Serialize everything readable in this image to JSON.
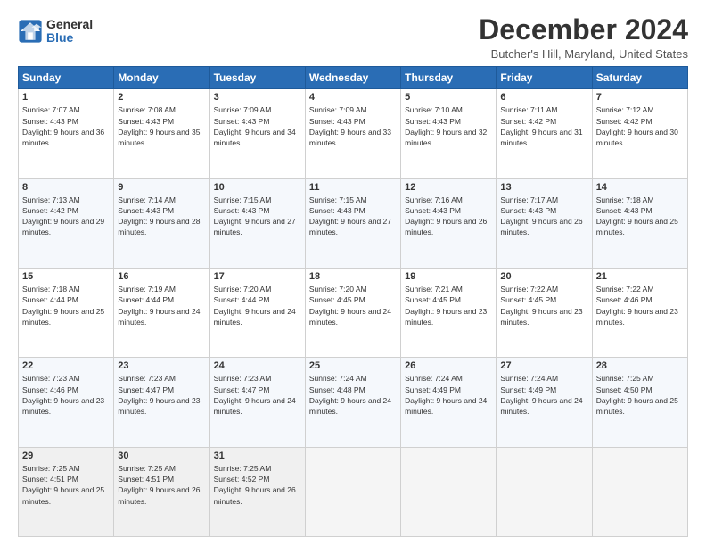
{
  "logo": {
    "general": "General",
    "blue": "Blue"
  },
  "header": {
    "month": "December 2024",
    "location": "Butcher's Hill, Maryland, United States"
  },
  "days_of_week": [
    "Sunday",
    "Monday",
    "Tuesday",
    "Wednesday",
    "Thursday",
    "Friday",
    "Saturday"
  ],
  "weeks": [
    [
      {
        "day": "1",
        "sunrise": "7:07 AM",
        "sunset": "4:43 PM",
        "daylight": "9 hours and 36 minutes."
      },
      {
        "day": "2",
        "sunrise": "7:08 AM",
        "sunset": "4:43 PM",
        "daylight": "9 hours and 35 minutes."
      },
      {
        "day": "3",
        "sunrise": "7:09 AM",
        "sunset": "4:43 PM",
        "daylight": "9 hours and 34 minutes."
      },
      {
        "day": "4",
        "sunrise": "7:09 AM",
        "sunset": "4:43 PM",
        "daylight": "9 hours and 33 minutes."
      },
      {
        "day": "5",
        "sunrise": "7:10 AM",
        "sunset": "4:43 PM",
        "daylight": "9 hours and 32 minutes."
      },
      {
        "day": "6",
        "sunrise": "7:11 AM",
        "sunset": "4:42 PM",
        "daylight": "9 hours and 31 minutes."
      },
      {
        "day": "7",
        "sunrise": "7:12 AM",
        "sunset": "4:42 PM",
        "daylight": "9 hours and 30 minutes."
      }
    ],
    [
      {
        "day": "8",
        "sunrise": "7:13 AM",
        "sunset": "4:42 PM",
        "daylight": "9 hours and 29 minutes."
      },
      {
        "day": "9",
        "sunrise": "7:14 AM",
        "sunset": "4:43 PM",
        "daylight": "9 hours and 28 minutes."
      },
      {
        "day": "10",
        "sunrise": "7:15 AM",
        "sunset": "4:43 PM",
        "daylight": "9 hours and 27 minutes."
      },
      {
        "day": "11",
        "sunrise": "7:15 AM",
        "sunset": "4:43 PM",
        "daylight": "9 hours and 27 minutes."
      },
      {
        "day": "12",
        "sunrise": "7:16 AM",
        "sunset": "4:43 PM",
        "daylight": "9 hours and 26 minutes."
      },
      {
        "day": "13",
        "sunrise": "7:17 AM",
        "sunset": "4:43 PM",
        "daylight": "9 hours and 26 minutes."
      },
      {
        "day": "14",
        "sunrise": "7:18 AM",
        "sunset": "4:43 PM",
        "daylight": "9 hours and 25 minutes."
      }
    ],
    [
      {
        "day": "15",
        "sunrise": "7:18 AM",
        "sunset": "4:44 PM",
        "daylight": "9 hours and 25 minutes."
      },
      {
        "day": "16",
        "sunrise": "7:19 AM",
        "sunset": "4:44 PM",
        "daylight": "9 hours and 24 minutes."
      },
      {
        "day": "17",
        "sunrise": "7:20 AM",
        "sunset": "4:44 PM",
        "daylight": "9 hours and 24 minutes."
      },
      {
        "day": "18",
        "sunrise": "7:20 AM",
        "sunset": "4:45 PM",
        "daylight": "9 hours and 24 minutes."
      },
      {
        "day": "19",
        "sunrise": "7:21 AM",
        "sunset": "4:45 PM",
        "daylight": "9 hours and 23 minutes."
      },
      {
        "day": "20",
        "sunrise": "7:22 AM",
        "sunset": "4:45 PM",
        "daylight": "9 hours and 23 minutes."
      },
      {
        "day": "21",
        "sunrise": "7:22 AM",
        "sunset": "4:46 PM",
        "daylight": "9 hours and 23 minutes."
      }
    ],
    [
      {
        "day": "22",
        "sunrise": "7:23 AM",
        "sunset": "4:46 PM",
        "daylight": "9 hours and 23 minutes."
      },
      {
        "day": "23",
        "sunrise": "7:23 AM",
        "sunset": "4:47 PM",
        "daylight": "9 hours and 23 minutes."
      },
      {
        "day": "24",
        "sunrise": "7:23 AM",
        "sunset": "4:47 PM",
        "daylight": "9 hours and 24 minutes."
      },
      {
        "day": "25",
        "sunrise": "7:24 AM",
        "sunset": "4:48 PM",
        "daylight": "9 hours and 24 minutes."
      },
      {
        "day": "26",
        "sunrise": "7:24 AM",
        "sunset": "4:49 PM",
        "daylight": "9 hours and 24 minutes."
      },
      {
        "day": "27",
        "sunrise": "7:24 AM",
        "sunset": "4:49 PM",
        "daylight": "9 hours and 24 minutes."
      },
      {
        "day": "28",
        "sunrise": "7:25 AM",
        "sunset": "4:50 PM",
        "daylight": "9 hours and 25 minutes."
      }
    ],
    [
      {
        "day": "29",
        "sunrise": "7:25 AM",
        "sunset": "4:51 PM",
        "daylight": "9 hours and 25 minutes."
      },
      {
        "day": "30",
        "sunrise": "7:25 AM",
        "sunset": "4:51 PM",
        "daylight": "9 hours and 26 minutes."
      },
      {
        "day": "31",
        "sunrise": "7:25 AM",
        "sunset": "4:52 PM",
        "daylight": "9 hours and 26 minutes."
      },
      null,
      null,
      null,
      null
    ]
  ]
}
